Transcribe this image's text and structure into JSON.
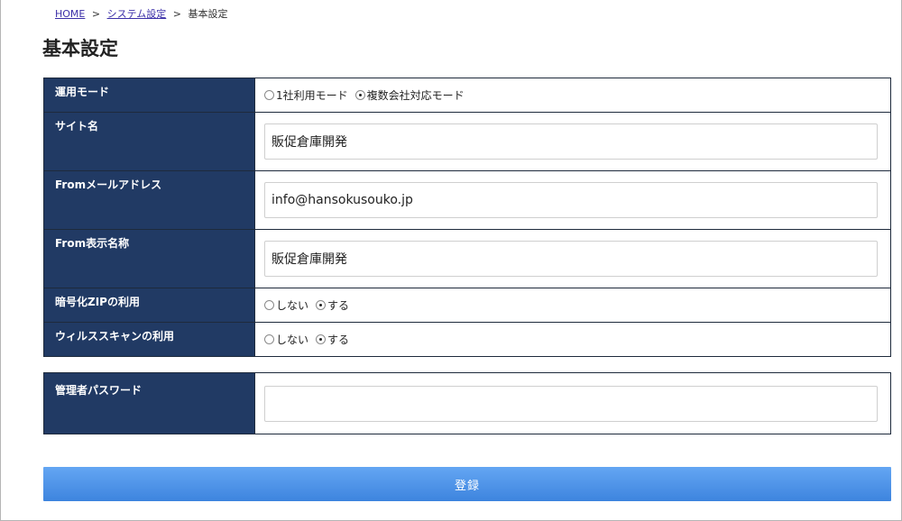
{
  "breadcrumb": {
    "home": "HOME",
    "separator": ">",
    "system_settings": "システム設定",
    "current": "基本設定"
  },
  "page_title": "基本設定",
  "form": {
    "operation_mode": {
      "label": "運用モード",
      "options": [
        "1社利用モード",
        "複数会社対応モード"
      ],
      "selected": "複数会社対応モード"
    },
    "site_name": {
      "label": "サイト名",
      "value": "販促倉庫開発"
    },
    "from_email": {
      "label": "Fromメールアドレス",
      "value": "info@hansokusouko.jp"
    },
    "from_display_name": {
      "label": "From表示名称",
      "value": "販促倉庫開発"
    },
    "encrypted_zip": {
      "label": "暗号化ZIPの利用",
      "options": [
        "しない",
        "する"
      ],
      "selected": "する"
    },
    "virus_scan": {
      "label": "ウィルススキャンの利用",
      "options": [
        "しない",
        "する"
      ],
      "selected": "する"
    },
    "admin_password": {
      "label": "管理者パスワード",
      "value": ""
    }
  },
  "submit_label": "登録"
}
